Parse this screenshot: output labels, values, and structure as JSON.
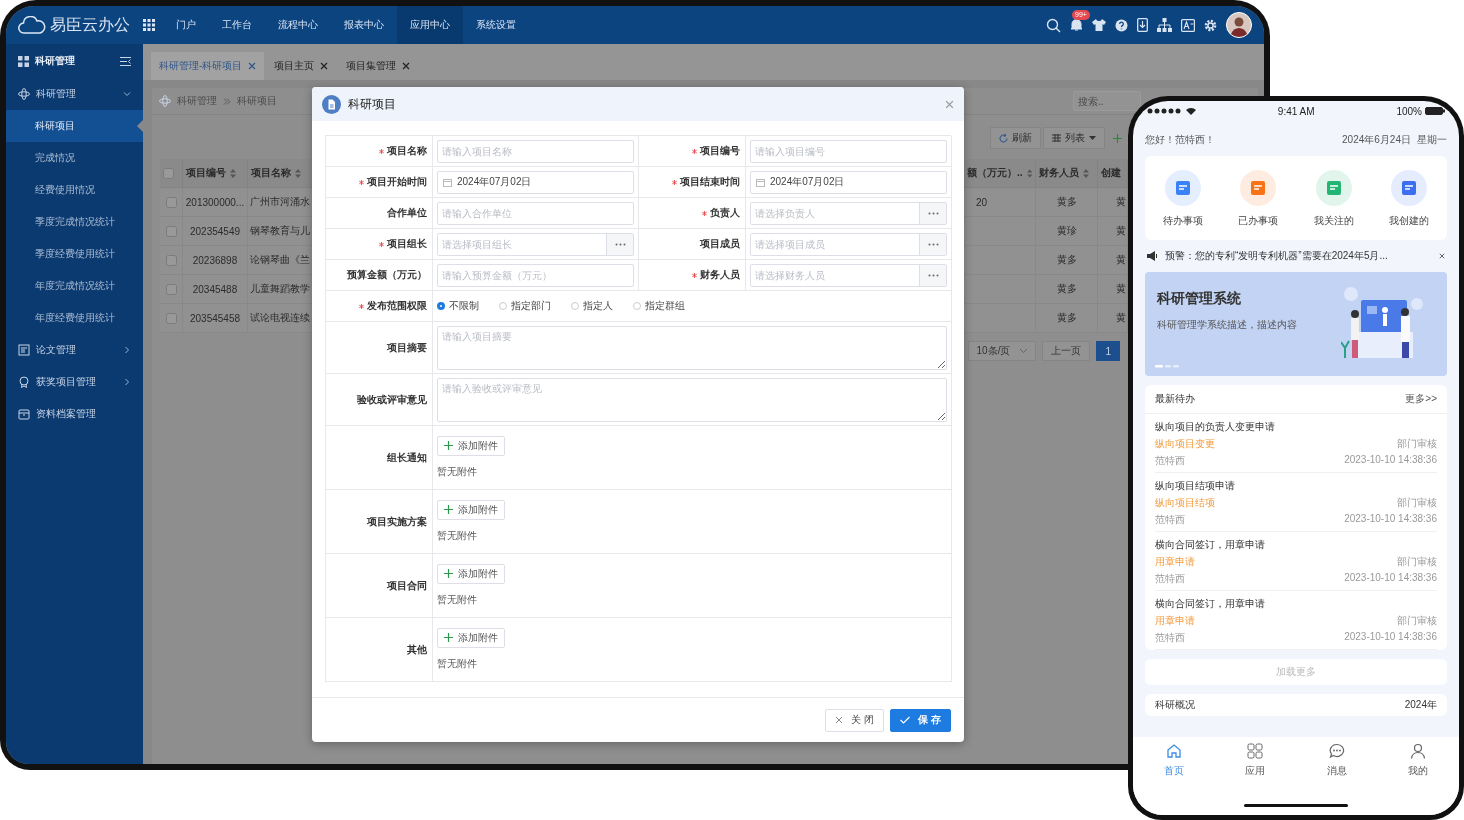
{
  "topbar": {
    "logo_text": "易臣云办公",
    "nav": [
      {
        "label": "门户",
        "selected": false
      },
      {
        "label": "工作台",
        "selected": false
      },
      {
        "label": "流程中心",
        "selected": false
      },
      {
        "label": "报表中心",
        "selected": false
      },
      {
        "label": "应用中心",
        "selected": true
      },
      {
        "label": "系统设置",
        "selected": false
      }
    ],
    "notification_badge": "99+"
  },
  "sidebar": {
    "title": "科研管理",
    "items": [
      {
        "label": "科研管理",
        "expanded": true,
        "children": [
          {
            "label": "科研项目",
            "selected": true
          },
          {
            "label": "完成情况",
            "selected": false
          },
          {
            "label": "经费使用情况",
            "selected": false
          },
          {
            "label": "季度完成情况统计",
            "selected": false
          },
          {
            "label": "季度经费使用统计",
            "selected": false
          },
          {
            "label": "年度完成情况统计",
            "selected": false
          },
          {
            "label": "年度经费使用统计",
            "selected": false
          }
        ]
      },
      {
        "label": "论文管理",
        "expanded": false
      },
      {
        "label": "获奖项目管理",
        "expanded": false
      },
      {
        "label": "资料档案管理"
      }
    ]
  },
  "tabs": [
    {
      "label": "科研管理-科研项目",
      "selected": true
    },
    {
      "label": "项目主页",
      "selected": false
    },
    {
      "label": "项目集管理",
      "selected": false
    }
  ],
  "breadcrumb": [
    "科研管理",
    "科研项目"
  ],
  "search": {
    "placeholder": "搜索.."
  },
  "toolbar": {
    "refresh": "刷新",
    "view": "列表"
  },
  "table": {
    "all_checked": false,
    "columns": [
      {
        "label": "项目编号",
        "sortable": true
      },
      {
        "label": "项目名称",
        "sortable": true
      },
      {
        "label": "额（万元）..",
        "sortable": true
      },
      {
        "label": "财务人员",
        "sortable": true
      },
      {
        "label": "创建"
      }
    ],
    "rows": [
      {
        "checked": false,
        "number": "201300000...",
        "name": "广州市河涌水",
        "amount": "20",
        "finance": "黄多",
        "creator": "黄"
      },
      {
        "checked": false,
        "number": "202354549",
        "name": "钢琴教育与儿",
        "finance": "黄珍",
        "creator": "黄"
      },
      {
        "checked": false,
        "number": "20236898",
        "name": "论钢琴曲《兰",
        "finance": "黄多",
        "creator": "黄"
      },
      {
        "checked": false,
        "number": "20345488",
        "name": "儿童舞蹈教学",
        "finance": "黄多",
        "creator": "黄"
      },
      {
        "checked": false,
        "number": "203545458",
        "name": "试论电视连续",
        "finance": "黄多",
        "creator": "黄"
      }
    ]
  },
  "pagination": {
    "page_size": "10条/页",
    "prev": "上一页",
    "pages": [
      {
        "label": "1",
        "selected": true
      }
    ]
  },
  "modal": {
    "title": "科研项目",
    "fields": [
      {
        "kind": "input",
        "label": "项目名称",
        "required": true,
        "placeholder": "请输入项目名称"
      },
      {
        "kind": "input",
        "label": "项目编号",
        "required": true,
        "placeholder": "请输入项目编号"
      },
      {
        "kind": "date",
        "label": "项目开始时间",
        "required": true,
        "value": "2024年07月02日"
      },
      {
        "kind": "date",
        "label": "项目结束时间",
        "required": true,
        "value": "2024年07月02日"
      },
      {
        "kind": "input",
        "label": "合作单位",
        "required": false,
        "placeholder": "请输入合作单位"
      },
      {
        "kind": "picker",
        "label": "负责人",
        "required": true,
        "placeholder": "请选择负责人"
      },
      {
        "kind": "picker",
        "label": "项目组长",
        "required": true,
        "placeholder": "请选择项目组长"
      },
      {
        "kind": "picker",
        "label": "项目成员",
        "required": false,
        "placeholder": "请选择项目成员"
      },
      {
        "kind": "input",
        "label": "预算金额（万元）",
        "required": false,
        "placeholder": "请输入预算金额（万元）"
      },
      {
        "kind": "picker",
        "label": "财务人员",
        "required": true,
        "placeholder": "请选择财务人员"
      },
      {
        "kind": "radio",
        "label": "发布范围权限",
        "required": true,
        "options": [
          {
            "label": "不限制",
            "selected": true
          },
          {
            "label": "指定部门",
            "selected": false
          },
          {
            "label": "指定人",
            "selected": false
          },
          {
            "label": "指定群组",
            "selected": false
          }
        ]
      },
      {
        "kind": "textarea",
        "label": "项目摘要",
        "required": false,
        "placeholder": "请输入项目摘要"
      },
      {
        "kind": "textarea",
        "label": "验收或评审意见",
        "required": false,
        "placeholder": "请输入验收或评审意见"
      },
      {
        "kind": "attachment",
        "label": "组长通知",
        "required": false,
        "button": "添加附件",
        "empty": "暂无附件"
      },
      {
        "kind": "attachment",
        "label": "项目实施方案",
        "required": false,
        "button": "添加附件",
        "empty": "暂无附件"
      },
      {
        "kind": "attachment",
        "label": "项目合同",
        "required": false,
        "button": "添加附件",
        "empty": "暂无附件"
      },
      {
        "kind": "attachment",
        "label": "其他",
        "required": false,
        "button": "添加附件",
        "empty": "暂无附件"
      }
    ],
    "buttons": [
      {
        "label": "关 闭",
        "kind": "default"
      },
      {
        "label": "保 存",
        "kind": "primary"
      }
    ]
  },
  "phone": {
    "time": "9:41 AM",
    "battery": "100%",
    "greeting": "您好！范特西！",
    "date": "2024年6月24日",
    "weekday": "星期一",
    "shortcuts": [
      {
        "label": "待办事项",
        "color": "#3b82f6"
      },
      {
        "label": "已办事项",
        "color": "#f97316"
      },
      {
        "label": "我关注的",
        "color": "#22b573"
      },
      {
        "label": "我创建的",
        "color": "#3b6ff0"
      }
    ],
    "notice": "预警：您的专利“发明专利机器”需要在2024年5月...",
    "banner": {
      "title": "科研管理系统",
      "subtitle": "科研管理学系统描述，描述内容"
    },
    "todo": {
      "title": "最新待办",
      "more": "更多>>",
      "items": [
        {
          "title": "纵向项目的负责人变更申请",
          "tag": "纵向项目变更",
          "person": "范特西",
          "status": "部门审核",
          "time": "2023-10-10 14:38:36"
        },
        {
          "title": "纵向项目结项申请",
          "tag": "纵向项目结项",
          "person": "范特西",
          "status": "部门审核",
          "time": "2023-10-10 14:38:36"
        },
        {
          "title": "横向合同签订，用章申请",
          "tag": "用章申请",
          "person": "范特西",
          "status": "部门审核",
          "time": "2023-10-10 14:38:36"
        },
        {
          "title": "横向合同签订，用章申请",
          "tag": "用章申请",
          "person": "范特西",
          "status": "部门审核",
          "time": "2023-10-10 14:38:36"
        }
      ],
      "load_more": "加载更多"
    },
    "overview": {
      "title": "科研概况",
      "year": "2024年"
    },
    "nav": [
      {
        "label": "首页",
        "selected": true
      },
      {
        "label": "应用",
        "selected": false
      },
      {
        "label": "消息",
        "selected": false
      },
      {
        "label": "我的",
        "selected": false
      }
    ]
  }
}
